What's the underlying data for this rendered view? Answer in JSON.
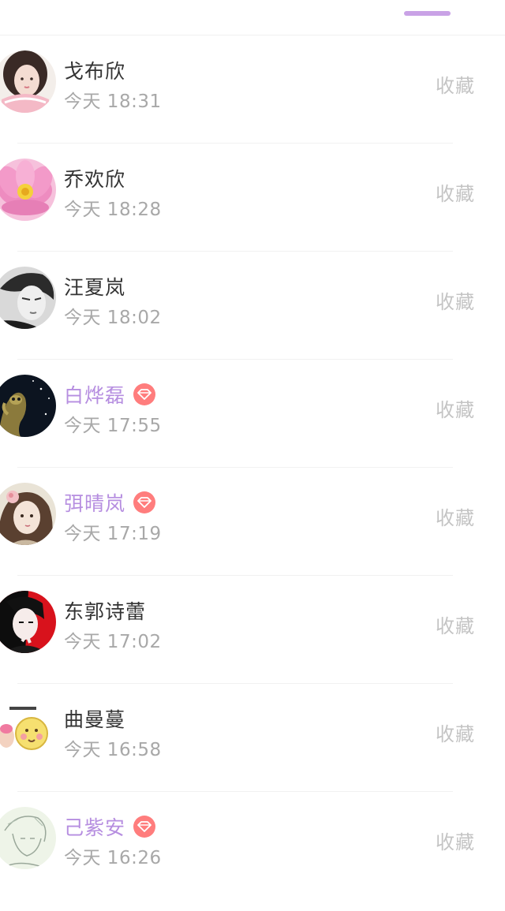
{
  "contacts": [
    {
      "name": "戈布欣",
      "time": "今天 18:31",
      "action": "收藏",
      "vip": false,
      "avatar": "girl-pink-scarf-avatar"
    },
    {
      "name": "乔欢欣",
      "time": "今天 18:28",
      "action": "收藏",
      "vip": false,
      "avatar": "lotus-flower-avatar"
    },
    {
      "name": "汪夏岚",
      "time": "今天 18:02",
      "action": "收藏",
      "vip": false,
      "avatar": "grayscale-boy-avatar"
    },
    {
      "name": "白烨磊",
      "time": "今天 17:55",
      "action": "收藏",
      "vip": true,
      "avatar": "dark-night-figure-avatar"
    },
    {
      "name": "弭晴岚",
      "time": "今天 17:19",
      "action": "收藏",
      "vip": true,
      "avatar": "anime-girl-flower-avatar"
    },
    {
      "name": "东郭诗蕾",
      "time": "今天 17:02",
      "action": "收藏",
      "vip": false,
      "avatar": "anime-boy-red-avatar"
    },
    {
      "name": "曲曼蔓",
      "time": "今天 16:58",
      "action": "收藏",
      "vip": false,
      "avatar": "emoji-clapping-avatar"
    },
    {
      "name": "己紫安",
      "time": "今天 16:26",
      "action": "收藏",
      "vip": true,
      "avatar": "sketch-line-art-avatar"
    }
  ],
  "colors": {
    "accent": "#c9a2e6",
    "vip_name": "#b68ee0",
    "vip_badge": "#ff7d7d",
    "name": "#333333",
    "muted": "#a8a8a8",
    "action": "#c4c4c4"
  }
}
